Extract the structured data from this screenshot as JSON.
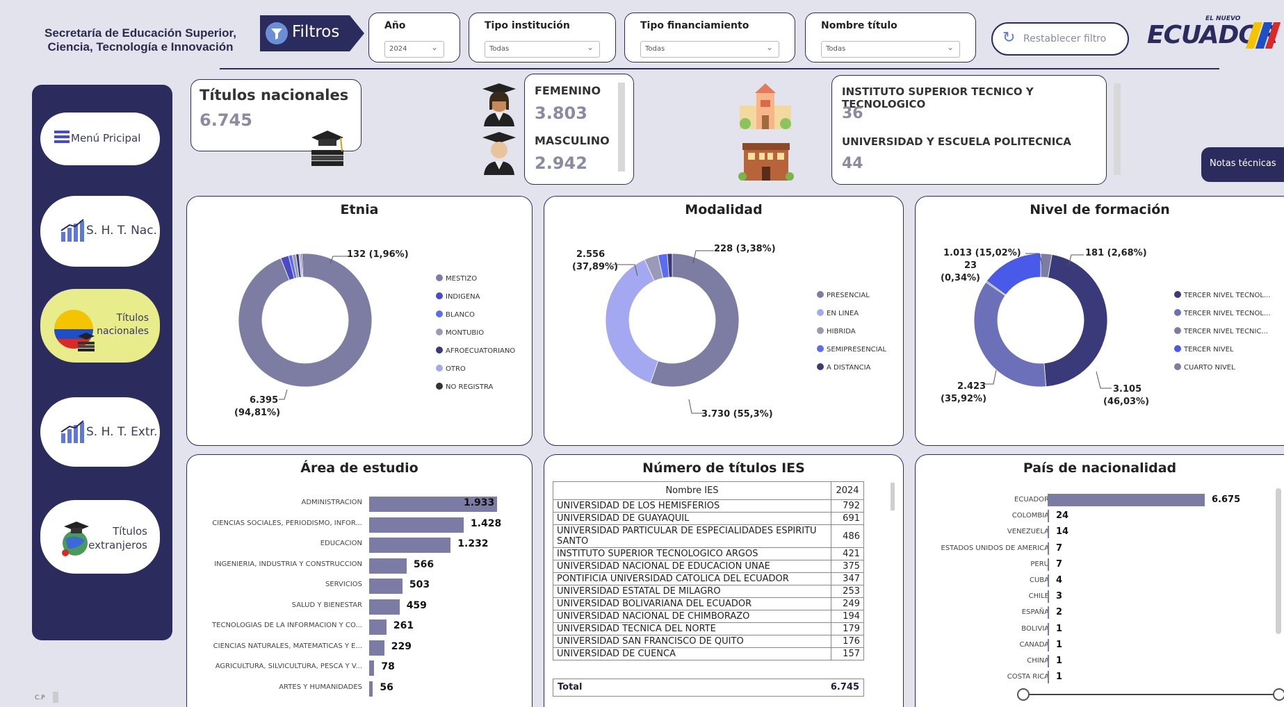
{
  "header": {
    "org_line1": "Secretaría de Educación Superior,",
    "org_line2": "Ciencia, Tecnología e Innovación",
    "filtros_label": "Filtros",
    "reset_label": "Restablecer filtro",
    "logo_small": "EL NUEVO",
    "logo_big": "ECUADOR"
  },
  "filters": [
    {
      "label": "Año",
      "value": "2024"
    },
    {
      "label": "Tipo institución",
      "value": "Todas"
    },
    {
      "label": "Tipo financiamiento",
      "value": "Todas"
    },
    {
      "label": "Nombre título",
      "value": "Todas"
    }
  ],
  "sidebar": {
    "items": [
      {
        "label": "Menú Pricipal"
      },
      {
        "label": "S. H. T. Nac."
      },
      {
        "label_line1": "Títulos",
        "label_line2": "nacionales"
      },
      {
        "label": "S. H. T. Extr."
      },
      {
        "label_line1": "Títulos",
        "label_line2": "extranjeros"
      }
    ],
    "footer": "C.P"
  },
  "kpi": {
    "titulos_label": "Títulos nacionales",
    "titulos_value": "6.745",
    "femenino_label": "FEMENINO",
    "femenino_value": "3.803",
    "masculino_label": "MASCULINO",
    "masculino_value": "2.942",
    "inst1_label": "INSTITUTO SUPERIOR TECNICO Y TECNOLOGICO",
    "inst1_value": "36",
    "inst2_label": "UNIVERSIDAD Y ESCUELA POLITECNICA",
    "inst2_value": "44",
    "notas_label": "Notas técnicas"
  },
  "charts": {
    "etnia": {
      "title": "Etnia",
      "labels": {
        "a": "132 (1,96%)",
        "b": "6.395",
        "c": "(94,81%)"
      }
    },
    "modalidad": {
      "title": "Modalidad",
      "labels": {
        "a": "228 (3,38%)",
        "b1": "2.556",
        "b2": "(37,89%)",
        "c": "3.730 (55,3%)"
      }
    },
    "nivel": {
      "title": "Nivel de formación",
      "labels": {
        "a": "1.013 (15,02%)",
        "b1": "23",
        "b2": "(0,34%)",
        "c": "181 (2,68%)",
        "d1": "2.423",
        "d2": "(35,92%)",
        "e1": "3.105",
        "e2": "(46,03%)"
      }
    },
    "area": {
      "title": "Área de estudio"
    },
    "ies": {
      "title": "Número de títulos IES"
    },
    "pais": {
      "title": "País de nacionalidad"
    }
  },
  "chart_data": [
    {
      "type": "pie",
      "title": "Etnia",
      "slices": [
        {
          "name": "MESTIZO",
          "value": 6395,
          "color": "#7d7da3"
        },
        {
          "name": "INDIGENA",
          "value": 132,
          "color": "#4a4ac8"
        },
        {
          "name": "BLANCO",
          "value": 60,
          "color": "#5b6cf0"
        },
        {
          "name": "MONTUBIO",
          "value": 60,
          "color": "#9a9ab8"
        },
        {
          "name": "AFROECUATORIANO",
          "value": 50,
          "color": "#3a3a7a"
        },
        {
          "name": "OTRO",
          "value": 30,
          "color": "#a3a8f0"
        },
        {
          "name": "NO REGISTRA",
          "value": 18,
          "color": "#333333"
        }
      ]
    },
    {
      "type": "pie",
      "title": "Modalidad",
      "slices": [
        {
          "name": "PRESENCIAL",
          "value": 3730,
          "color": "#7d7da3"
        },
        {
          "name": "EN LINEA",
          "value": 2556,
          "color": "#a3a8f0"
        },
        {
          "name": "HIBRIDA",
          "value": 228,
          "color": "#9a9ab8"
        },
        {
          "name": "SEMIPRESENCIAL",
          "value": 150,
          "color": "#5b6cf0"
        },
        {
          "name": "A DISTANCIA",
          "value": 81,
          "color": "#3a3a7a"
        }
      ]
    },
    {
      "type": "pie",
      "title": "Nivel de formación",
      "slices": [
        {
          "name": "TERCER NIVEL TECNOL...",
          "value": 3105,
          "color": "#3a3a7a"
        },
        {
          "name": "TERCER NIVEL TECNOL...",
          "value": 2423,
          "color": "#6b70b8"
        },
        {
          "name": "TERCER NIVEL TECNIC...",
          "value": 23,
          "color": "#7d7da3"
        },
        {
          "name": "TERCER NIVEL",
          "value": 1013,
          "color": "#4a5ae8"
        },
        {
          "name": "CUARTO NIVEL",
          "value": 181,
          "color": "#7d7da3"
        }
      ]
    },
    {
      "type": "bar",
      "title": "Área de estudio",
      "categories": [
        "ADMINISTRACION",
        "CIENCIAS SOCIALES, PERIODISMO, INFOR...",
        "EDUCACION",
        "INGENIERIA, INDUSTRIA Y CONSTRUCCION",
        "SERVICIOS",
        "SALUD Y BIENESTAR",
        "TECNOLOGIAS DE LA INFORMACION Y CO...",
        "CIENCIAS NATURALES, MATEMATICAS Y E...",
        "AGRICULTURA, SILVICULTURA, PESCA Y V...",
        "ARTES Y HUMANIDADES"
      ],
      "values": [
        1933,
        1428,
        1232,
        566,
        503,
        459,
        261,
        229,
        78,
        56
      ],
      "labels": [
        "1.933",
        "1.428",
        "1.232",
        "566",
        "503",
        "459",
        "261",
        "229",
        "78",
        "56"
      ]
    },
    {
      "type": "table",
      "title": "Número de títulos IES",
      "columns": [
        "Nombre IES",
        "2024"
      ],
      "rows": [
        [
          "UNIVERSIDAD DE LOS HEMISFERIOS",
          "792"
        ],
        [
          "UNIVERSIDAD DE GUAYAQUIL",
          "691"
        ],
        [
          "UNIVERSIDAD PARTICULAR DE ESPECIALIDADES ESPIRITU SANTO",
          "486"
        ],
        [
          "INSTITUTO SUPERIOR TECNOLOGICO ARGOS",
          "421"
        ],
        [
          "UNIVERSIDAD NACIONAL DE EDUCACION UNAE",
          "375"
        ],
        [
          "PONTIFICIA UNIVERSIDAD CATOLICA DEL ECUADOR",
          "347"
        ],
        [
          "UNIVERSIDAD ESTATAL DE MILAGRO",
          "253"
        ],
        [
          "UNIVERSIDAD BOLIVARIANA DEL ECUADOR",
          "249"
        ],
        [
          "UNIVERSIDAD NACIONAL DE CHIMBORAZO",
          "194"
        ],
        [
          "UNIVERSIDAD TECNICA DEL NORTE",
          "179"
        ],
        [
          "UNIVERSIDAD SAN FRANCISCO DE QUITO",
          "176"
        ],
        [
          "UNIVERSIDAD DE CUENCA",
          "157"
        ]
      ],
      "total_label": "Total",
      "total_value": "6.745"
    },
    {
      "type": "bar",
      "title": "País de nacionalidad",
      "categories": [
        "ECUADOR",
        "COLOMBIA",
        "VENEZUELA",
        "ESTADOS UNIDOS DE AMERICA",
        "PERU",
        "CUBA",
        "CHILE",
        "ESPAÑA",
        "BOLIVIA",
        "CANADA",
        "CHINA",
        "COSTA RICA"
      ],
      "values": [
        6675,
        24,
        14,
        7,
        7,
        4,
        3,
        2,
        1,
        1,
        1,
        1
      ],
      "labels": [
        "6.675",
        "24",
        "14",
        "7",
        "7",
        "4",
        "3",
        "2",
        "1",
        "1",
        "1",
        "1"
      ]
    }
  ]
}
